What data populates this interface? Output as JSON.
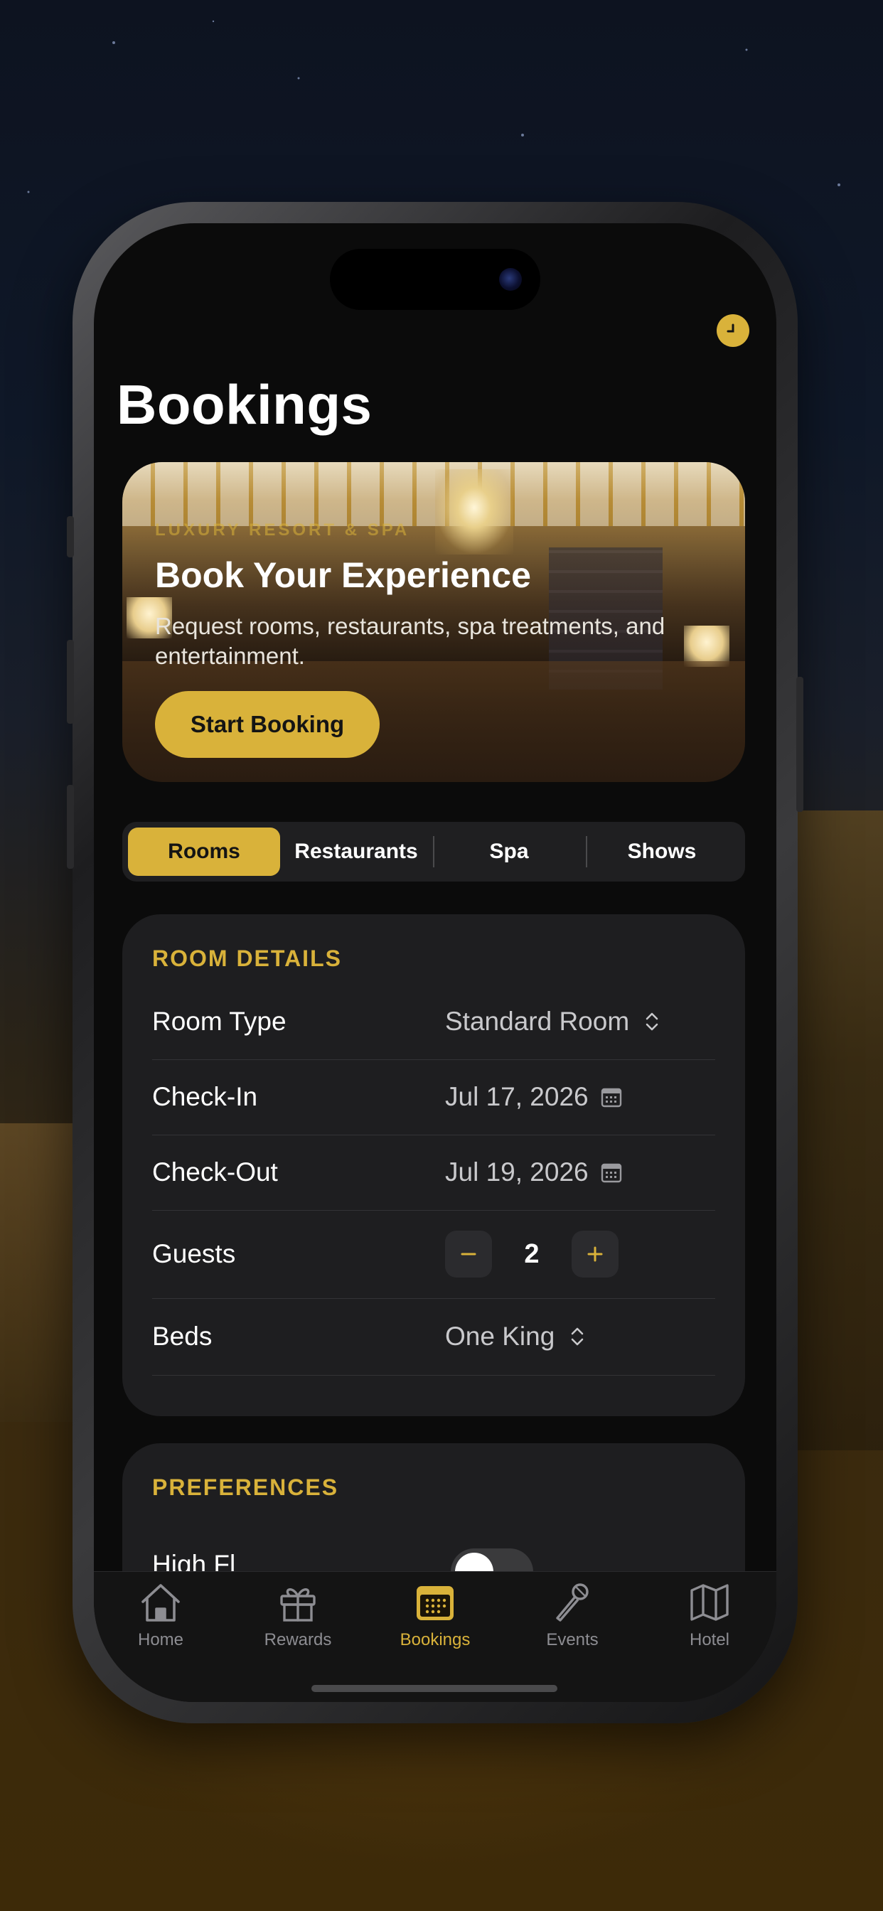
{
  "page": {
    "title": "Bookings"
  },
  "hero": {
    "eyebrow": "LUXURY RESORT & SPA",
    "title": "Book Your Experience",
    "subtitle": "Request rooms, restaurants, spa treatments, and entertainment.",
    "button_label": "Start Booking"
  },
  "segments": [
    {
      "label": "Rooms",
      "selected": true
    },
    {
      "label": "Restaurants",
      "selected": false
    },
    {
      "label": "Spa",
      "selected": false
    },
    {
      "label": "Shows",
      "selected": false
    }
  ],
  "room_details": {
    "header": "ROOM DETAILS",
    "room_type": {
      "label": "Room Type",
      "value": "Standard Room",
      "icon": "chevron-up-down-icon"
    },
    "check_in": {
      "label": "Check-In",
      "value": "Jul 17, 2026",
      "icon": "calendar-icon"
    },
    "check_out": {
      "label": "Check-Out",
      "value": "Jul 19, 2026",
      "icon": "calendar-icon"
    },
    "guests": {
      "label": "Guests",
      "value": "2"
    },
    "beds": {
      "label": "Beds",
      "value": "One King",
      "icon": "chevron-up-down-icon"
    }
  },
  "preferences": {
    "header": "PREFERENCES",
    "first_item_label": "High Fl",
    "first_item_toggle_on": false
  },
  "tabbar": [
    {
      "label": "Home",
      "icon": "house-icon",
      "selected": false
    },
    {
      "label": "Rewards",
      "icon": "gift-icon",
      "selected": false
    },
    {
      "label": "Bookings",
      "icon": "calendar-grid-icon",
      "selected": true
    },
    {
      "label": "Events",
      "icon": "microphone-icon",
      "selected": false
    },
    {
      "label": "Hotel",
      "icon": "map-icon",
      "selected": false
    }
  ],
  "colors": {
    "accent": "#d9b23a",
    "background": "#0b0b0b",
    "card": "#1e1e20",
    "inactive_tab": "#8d8d92"
  }
}
